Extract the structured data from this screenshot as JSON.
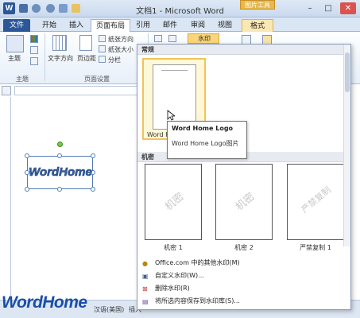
{
  "titlebar": {
    "title": "文档1 - Microsoft Word",
    "context_group": "图片工具",
    "app_icon": "W",
    "win_minimize": "–",
    "win_maximize": "□",
    "win_close": "✕"
  },
  "tabs": [
    "文件",
    "开始",
    "插入",
    "页面布局",
    "引用",
    "邮件",
    "审阅",
    "视图",
    "格式"
  ],
  "ribbon": {
    "theme_label": "主题",
    "text_direction": "文字方向",
    "margins": "页边距",
    "orientation": "纸张方向",
    "size": "纸张大小",
    "columns": "分栏",
    "watermark": "水印",
    "group_themes": "主题",
    "group_page_setup": "页面设置"
  },
  "document": {
    "wordart_text": "WordHome"
  },
  "gallery": {
    "section_general": "常规",
    "section_confidential": "机密",
    "tooltip_title": "Word Home Logo",
    "tooltip_body": "Word Home Logo图片",
    "first_thumb_caption": "Word H",
    "thumbs": [
      {
        "caption": "机密 1",
        "watermark": "机密"
      },
      {
        "caption": "机密 2",
        "watermark": "机密"
      },
      {
        "caption": "严禁复制 1",
        "watermark": "严禁复制"
      }
    ],
    "menu": [
      {
        "icon": "●",
        "label": "Office.com 中的其他水印(M)"
      },
      {
        "icon": "▣",
        "label": "自定义水印(W)..."
      },
      {
        "icon": "⊠",
        "label": "删除水印(R)"
      },
      {
        "icon": "▤",
        "label": "将所选内容保存到水印库(S)..."
      }
    ]
  },
  "statusbar": {
    "language": "汉语(美国)",
    "insert": "插入"
  },
  "brand": "WordHome",
  "colors": {
    "word_blue": "#2b5797",
    "context_gold": "#e8b94a",
    "wordart_blue": "#3563a8"
  }
}
